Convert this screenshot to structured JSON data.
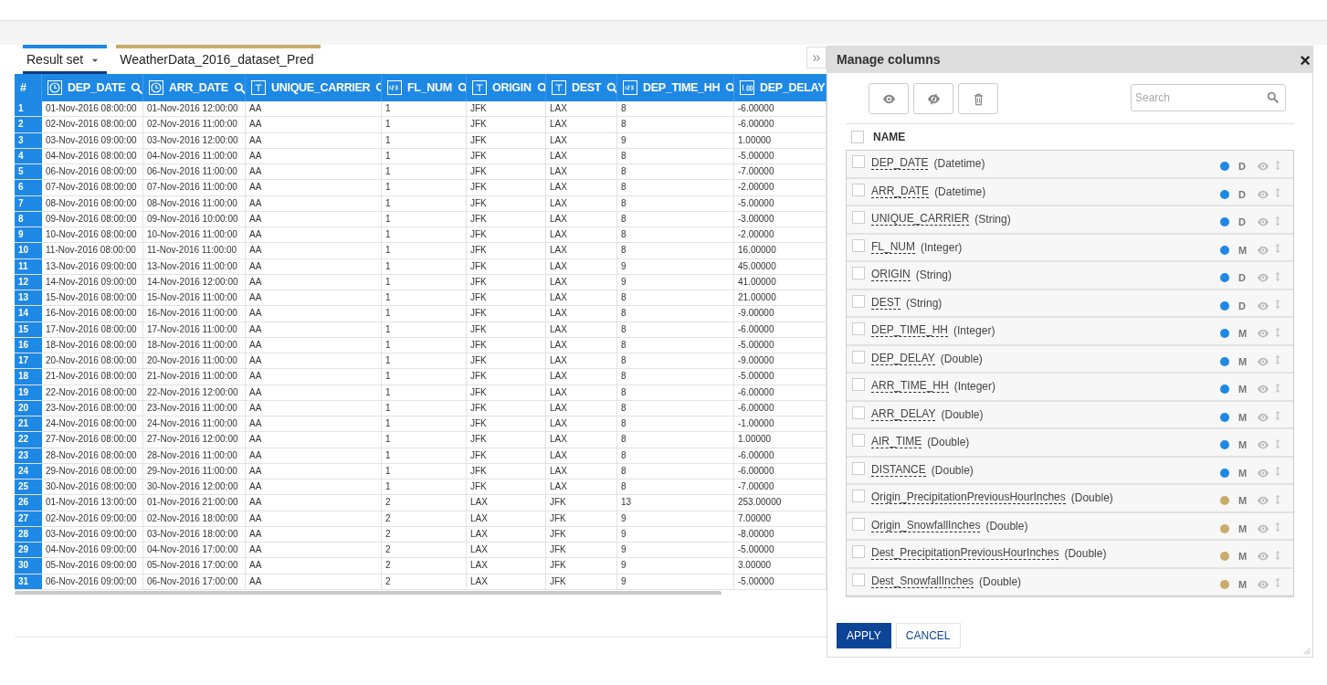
{
  "tabs": [
    {
      "label": "Result set",
      "selected": true,
      "has_menu": true,
      "color": "#1e88e5"
    },
    {
      "label": "WeatherData_2016_dataset_Pred",
      "selected": false,
      "has_menu": false,
      "color": "#c8ac6a"
    }
  ],
  "expand_button": "»",
  "table": {
    "columns": [
      {
        "label": "#",
        "kind": "index"
      },
      {
        "label": "DEP_DATE",
        "kind": "datetime"
      },
      {
        "label": "ARR_DATE",
        "kind": "datetime"
      },
      {
        "label": "UNIQUE_CARRIER",
        "kind": "string"
      },
      {
        "label": "FL_NUM",
        "kind": "integer"
      },
      {
        "label": "ORIGIN",
        "kind": "string"
      },
      {
        "label": "DEST",
        "kind": "string"
      },
      {
        "label": "DEP_TIME_HH",
        "kind": "integer"
      },
      {
        "label": "DEP_DELAY",
        "kind": "double"
      }
    ],
    "rows": [
      [
        "1",
        "01-Nov-2016 08:00:00",
        "01-Nov-2016 12:00:00",
        "AA",
        "1",
        "JFK",
        "LAX",
        "8",
        "-6.00000"
      ],
      [
        "2",
        "02-Nov-2016 08:00:00",
        "02-Nov-2016 11:00:00",
        "AA",
        "1",
        "JFK",
        "LAX",
        "8",
        "-6.00000"
      ],
      [
        "3",
        "03-Nov-2016 09:00:00",
        "03-Nov-2016 12:00:00",
        "AA",
        "1",
        "JFK",
        "LAX",
        "9",
        "1.00000"
      ],
      [
        "4",
        "04-Nov-2016 08:00:00",
        "04-Nov-2016 11:00:00",
        "AA",
        "1",
        "JFK",
        "LAX",
        "8",
        "-5.00000"
      ],
      [
        "5",
        "06-Nov-2016 08:00:00",
        "06-Nov-2016 11:00:00",
        "AA",
        "1",
        "JFK",
        "LAX",
        "8",
        "-7.00000"
      ],
      [
        "6",
        "07-Nov-2016 08:00:00",
        "07-Nov-2016 11:00:00",
        "AA",
        "1",
        "JFK",
        "LAX",
        "8",
        "-2.00000"
      ],
      [
        "7",
        "08-Nov-2016 08:00:00",
        "08-Nov-2016 11:00:00",
        "AA",
        "1",
        "JFK",
        "LAX",
        "8",
        "-5.00000"
      ],
      [
        "8",
        "09-Nov-2016 08:00:00",
        "09-Nov-2016 10:00:00",
        "AA",
        "1",
        "JFK",
        "LAX",
        "8",
        "-3.00000"
      ],
      [
        "9",
        "10-Nov-2016 08:00:00",
        "10-Nov-2016 11:00:00",
        "AA",
        "1",
        "JFK",
        "LAX",
        "8",
        "-2.00000"
      ],
      [
        "10",
        "11-Nov-2016 08:00:00",
        "11-Nov-2016 11:00:00",
        "AA",
        "1",
        "JFK",
        "LAX",
        "8",
        "16.00000"
      ],
      [
        "11",
        "13-Nov-2016 09:00:00",
        "13-Nov-2016 11:00:00",
        "AA",
        "1",
        "JFK",
        "LAX",
        "9",
        "45.00000"
      ],
      [
        "12",
        "14-Nov-2016 09:00:00",
        "14-Nov-2016 12:00:00",
        "AA",
        "1",
        "JFK",
        "LAX",
        "9",
        "41.00000"
      ],
      [
        "13",
        "15-Nov-2016 08:00:00",
        "15-Nov-2016 11:00:00",
        "AA",
        "1",
        "JFK",
        "LAX",
        "8",
        "21.00000"
      ],
      [
        "14",
        "16-Nov-2016 08:00:00",
        "16-Nov-2016 11:00:00",
        "AA",
        "1",
        "JFK",
        "LAX",
        "8",
        "-9.00000"
      ],
      [
        "15",
        "17-Nov-2016 08:00:00",
        "17-Nov-2016 11:00:00",
        "AA",
        "1",
        "JFK",
        "LAX",
        "8",
        "-6.00000"
      ],
      [
        "16",
        "18-Nov-2016 08:00:00",
        "18-Nov-2016 11:00:00",
        "AA",
        "1",
        "JFK",
        "LAX",
        "8",
        "-5.00000"
      ],
      [
        "17",
        "20-Nov-2016 08:00:00",
        "20-Nov-2016 11:00:00",
        "AA",
        "1",
        "JFK",
        "LAX",
        "8",
        "-9.00000"
      ],
      [
        "18",
        "21-Nov-2016 08:00:00",
        "21-Nov-2016 11:00:00",
        "AA",
        "1",
        "JFK",
        "LAX",
        "8",
        "-5.00000"
      ],
      [
        "19",
        "22-Nov-2016 08:00:00",
        "22-Nov-2016 12:00:00",
        "AA",
        "1",
        "JFK",
        "LAX",
        "8",
        "-6.00000"
      ],
      [
        "20",
        "23-Nov-2016 08:00:00",
        "23-Nov-2016 11:00:00",
        "AA",
        "1",
        "JFK",
        "LAX",
        "8",
        "-6.00000"
      ],
      [
        "21",
        "24-Nov-2016 08:00:00",
        "24-Nov-2016 11:00:00",
        "AA",
        "1",
        "JFK",
        "LAX",
        "8",
        "-1.00000"
      ],
      [
        "22",
        "27-Nov-2016 08:00:00",
        "27-Nov-2016 12:00:00",
        "AA",
        "1",
        "JFK",
        "LAX",
        "8",
        "1.00000"
      ],
      [
        "23",
        "28-Nov-2016 08:00:00",
        "28-Nov-2016 11:00:00",
        "AA",
        "1",
        "JFK",
        "LAX",
        "8",
        "-6.00000"
      ],
      [
        "24",
        "29-Nov-2016 08:00:00",
        "29-Nov-2016 11:00:00",
        "AA",
        "1",
        "JFK",
        "LAX",
        "8",
        "-6.00000"
      ],
      [
        "25",
        "30-Nov-2016 08:00:00",
        "30-Nov-2016 12:00:00",
        "AA",
        "1",
        "JFK",
        "LAX",
        "8",
        "-7.00000"
      ],
      [
        "26",
        "01-Nov-2016 13:00:00",
        "01-Nov-2016 21:00:00",
        "AA",
        "2",
        "LAX",
        "JFK",
        "13",
        "253.00000"
      ],
      [
        "27",
        "02-Nov-2016 09:00:00",
        "02-Nov-2016 18:00:00",
        "AA",
        "2",
        "LAX",
        "JFK",
        "9",
        "7.00000"
      ],
      [
        "28",
        "03-Nov-2016 09:00:00",
        "03-Nov-2016 18:00:00",
        "AA",
        "2",
        "LAX",
        "JFK",
        "9",
        "-8.00000"
      ],
      [
        "29",
        "04-Nov-2016 09:00:00",
        "04-Nov-2016 17:00:00",
        "AA",
        "2",
        "LAX",
        "JFK",
        "9",
        "-5.00000"
      ],
      [
        "30",
        "05-Nov-2016 09:00:00",
        "05-Nov-2016 17:00:00",
        "AA",
        "2",
        "LAX",
        "JFK",
        "9",
        "3.00000"
      ],
      [
        "31",
        "06-Nov-2016 09:00:00",
        "06-Nov-2016 17:00:00",
        "AA",
        "2",
        "LAX",
        "JFK",
        "9",
        "-5.00000"
      ]
    ]
  },
  "panel": {
    "title": "Manage columns",
    "close": "×",
    "search": {
      "placeholder": "Search"
    },
    "header": "NAME",
    "all_checked": false,
    "items": [
      {
        "name": "DEP_DATE",
        "type": "(Datetime)",
        "checked": false,
        "color": "#1e88e5",
        "role": "D"
      },
      {
        "name": "ARR_DATE",
        "type": "(Datetime)",
        "checked": false,
        "color": "#1e88e5",
        "role": "D"
      },
      {
        "name": "UNIQUE_CARRIER",
        "type": "(String)",
        "checked": false,
        "color": "#1e88e5",
        "role": "D"
      },
      {
        "name": "FL_NUM",
        "type": "(Integer)",
        "checked": false,
        "color": "#1e88e5",
        "role": "M"
      },
      {
        "name": "ORIGIN",
        "type": "(String)",
        "checked": false,
        "color": "#1e88e5",
        "role": "D"
      },
      {
        "name": "DEST",
        "type": "(String)",
        "checked": false,
        "color": "#1e88e5",
        "role": "D"
      },
      {
        "name": "DEP_TIME_HH",
        "type": "(Integer)",
        "checked": false,
        "color": "#1e88e5",
        "role": "M"
      },
      {
        "name": "DEP_DELAY",
        "type": "(Double)",
        "checked": false,
        "color": "#1e88e5",
        "role": "M"
      },
      {
        "name": "ARR_TIME_HH",
        "type": "(Integer)",
        "checked": false,
        "color": "#1e88e5",
        "role": "M"
      },
      {
        "name": "ARR_DELAY",
        "type": "(Double)",
        "checked": false,
        "color": "#1e88e5",
        "role": "M"
      },
      {
        "name": "AIR_TIME",
        "type": "(Double)",
        "checked": false,
        "color": "#1e88e5",
        "role": "M"
      },
      {
        "name": "DISTANCE",
        "type": "(Double)",
        "checked": false,
        "color": "#1e88e5",
        "role": "M"
      },
      {
        "name": "Origin_PrecipitationPreviousHourInches",
        "type": "(Double)",
        "checked": false,
        "color": "#c8ac6a",
        "role": "M"
      },
      {
        "name": "Origin_SnowfallInches",
        "type": "(Double)",
        "checked": false,
        "color": "#c8ac6a",
        "role": "M"
      },
      {
        "name": "Dest_PrecipitationPreviousHourInches",
        "type": "(Double)",
        "checked": false,
        "color": "#c8ac6a",
        "role": "M"
      },
      {
        "name": "Dest_SnowfallInches",
        "type": "(Double)",
        "checked": false,
        "color": "#c8ac6a",
        "role": "M"
      }
    ],
    "buttons": [
      {
        "label": "APPLY",
        "kind": "primary"
      },
      {
        "label": "CANCEL",
        "kind": "secondary"
      }
    ]
  }
}
